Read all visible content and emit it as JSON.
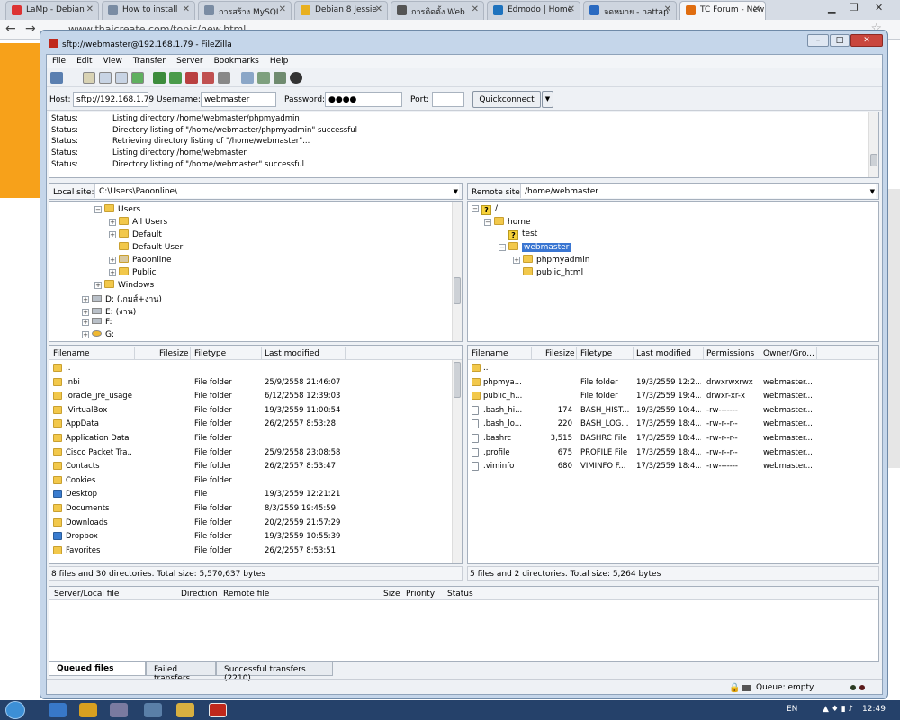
{
  "browser": {
    "tabs": [
      {
        "label": "LaMp - Debian"
      },
      {
        "label": "How to install"
      },
      {
        "label": "การสร้าง MySQL"
      },
      {
        "label": "Debian 8 Jessie"
      },
      {
        "label": "การติดตั้ง Web"
      },
      {
        "label": "Edmodo | Home"
      },
      {
        "label": "จดหมาย - nattap"
      },
      {
        "label": "TC Forum - New"
      }
    ],
    "url": "www.thaicreate.com/topic/new.html"
  },
  "window": {
    "title": "sftp://webmaster@192.168.1.79 - FileZilla",
    "minimize": "–",
    "maximize": "□",
    "close": "✕"
  },
  "menu": [
    "File",
    "Edit",
    "View",
    "Transfer",
    "Server",
    "Bookmarks",
    "Help"
  ],
  "quickconnect": {
    "host_label": "Host:",
    "host": "sftp://192.168.1.79",
    "user_label": "Username:",
    "user": "webmaster",
    "pass_label": "Password:",
    "pass": "●●●●",
    "port_label": "Port:",
    "port": "",
    "button": "Quickconnect",
    "arrow": "▼"
  },
  "log": [
    {
      "k": "Status:",
      "v": "Listing directory /home/webmaster/phpmyadmin"
    },
    {
      "k": "Status:",
      "v": "Directory listing of \"/home/webmaster/phpmyadmin\" successful"
    },
    {
      "k": "Status:",
      "v": "Retrieving directory listing of \"/home/webmaster\"..."
    },
    {
      "k": "Status:",
      "v": "Listing directory /home/webmaster"
    },
    {
      "k": "Status:",
      "v": "Directory listing of \"/home/webmaster\" successful"
    }
  ],
  "local": {
    "site_label": "Local site:",
    "path": "C:\\Users\\Paoonline\\",
    "tree": [
      {
        "label": "Users",
        "pm": "−",
        "icon": "folder"
      },
      {
        "label": "All Users",
        "pm": "+",
        "icon": "folder"
      },
      {
        "label": "Default",
        "pm": "+",
        "icon": "folder"
      },
      {
        "label": "Default User",
        "pm": "",
        "icon": "folder"
      },
      {
        "label": "Paoonline",
        "pm": "+",
        "icon": "user"
      },
      {
        "label": "Public",
        "pm": "+",
        "icon": "folder"
      },
      {
        "label": "Windows",
        "pm": "+",
        "icon": "folder"
      },
      {
        "label": "D: (เกมส์+งาน)",
        "pm": "+",
        "icon": "drive"
      },
      {
        "label": "E: (งาน)",
        "pm": "+",
        "icon": "drive"
      },
      {
        "label": "F:",
        "pm": "+",
        "icon": "drive"
      },
      {
        "label": "G:",
        "pm": "+",
        "icon": "drive"
      }
    ],
    "headers": [
      "Filename",
      "Filesize",
      "Filetype",
      "Last modified"
    ],
    "rows": [
      {
        "name": "..",
        "size": "",
        "type": "",
        "mod": "",
        "icon": "folder"
      },
      {
        "name": ".nbi",
        "size": "",
        "type": "File folder",
        "mod": "25/9/2558 21:46:07",
        "icon": "folder"
      },
      {
        "name": ".oracle_jre_usage",
        "size": "",
        "type": "File folder",
        "mod": "6/12/2558 12:39:03",
        "icon": "folder"
      },
      {
        "name": ".VirtualBox",
        "size": "",
        "type": "File folder",
        "mod": "19/3/2559 11:00:54",
        "icon": "folder"
      },
      {
        "name": "AppData",
        "size": "",
        "type": "File folder",
        "mod": "26/2/2557 8:53:28",
        "icon": "folder"
      },
      {
        "name": "Application Data",
        "size": "",
        "type": "File folder",
        "mod": "",
        "icon": "folder"
      },
      {
        "name": "Cisco Packet Tra...",
        "size": "",
        "type": "File folder",
        "mod": "25/9/2558 23:08:58",
        "icon": "folder"
      },
      {
        "name": "Contacts",
        "size": "",
        "type": "File folder",
        "mod": "26/2/2557 8:53:47",
        "icon": "folder"
      },
      {
        "name": "Cookies",
        "size": "",
        "type": "File folder",
        "mod": "",
        "icon": "folder"
      },
      {
        "name": "Desktop",
        "size": "",
        "type": "File",
        "mod": "19/3/2559 12:21:21",
        "icon": "blue"
      },
      {
        "name": "Documents",
        "size": "",
        "type": "File folder",
        "mod": "8/3/2559 19:45:59",
        "icon": "folder"
      },
      {
        "name": "Downloads",
        "size": "",
        "type": "File folder",
        "mod": "20/2/2559 21:57:29",
        "icon": "folder"
      },
      {
        "name": "Dropbox",
        "size": "",
        "type": "File folder",
        "mod": "19/3/2559 10:55:39",
        "icon": "blue"
      },
      {
        "name": "Favorites",
        "size": "",
        "type": "File folder",
        "mod": "26/2/2557 8:53:51",
        "icon": "folder"
      }
    ],
    "status": "8 files and 30 directories. Total size: 5,570,637 bytes"
  },
  "remote": {
    "site_label": "Remote site:",
    "path": "/home/webmaster",
    "tree": [
      {
        "label": "/",
        "pm": "−",
        "icon": "q"
      },
      {
        "label": "home",
        "pm": "−",
        "icon": "folder"
      },
      {
        "label": "test",
        "pm": "",
        "icon": "q"
      },
      {
        "label": "webmaster",
        "pm": "−",
        "icon": "folder"
      },
      {
        "label": "phpmyadmin",
        "pm": "+",
        "icon": "folder"
      },
      {
        "label": "public_html",
        "pm": "",
        "icon": "folder"
      }
    ],
    "headers": [
      "Filename",
      "Filesize",
      "Filetype",
      "Last modified",
      "Permissions",
      "Owner/Gro..."
    ],
    "rows": [
      {
        "name": "..",
        "size": "",
        "type": "",
        "mod": "",
        "perm": "",
        "owner": "",
        "icon": "folder"
      },
      {
        "name": "phpmya...",
        "size": "",
        "type": "File folder",
        "mod": "19/3/2559 12:2...",
        "perm": "drwxrwxrwx",
        "owner": "webmaster...",
        "icon": "folder"
      },
      {
        "name": "public_h...",
        "size": "",
        "type": "File folder",
        "mod": "17/3/2559 19:4...",
        "perm": "drwxr-xr-x",
        "owner": "webmaster...",
        "icon": "folder"
      },
      {
        "name": ".bash_hi...",
        "size": "174",
        "type": "BASH_HIST...",
        "mod": "19/3/2559 10:4...",
        "perm": "-rw-------",
        "owner": "webmaster...",
        "icon": "doc"
      },
      {
        "name": ".bash_lo...",
        "size": "220",
        "type": "BASH_LOG...",
        "mod": "17/3/2559 18:4...",
        "perm": "-rw-r--r--",
        "owner": "webmaster...",
        "icon": "doc"
      },
      {
        "name": ".bashrc",
        "size": "3,515",
        "type": "BASHRC File",
        "mod": "17/3/2559 18:4...",
        "perm": "-rw-r--r--",
        "owner": "webmaster...",
        "icon": "doc"
      },
      {
        "name": ".profile",
        "size": "675",
        "type": "PROFILE File",
        "mod": "17/3/2559 18:4...",
        "perm": "-rw-r--r--",
        "owner": "webmaster...",
        "icon": "doc"
      },
      {
        "name": ".viminfo",
        "size": "680",
        "type": "VIMINFO F...",
        "mod": "17/3/2559 18:4...",
        "perm": "-rw-------",
        "owner": "webmaster...",
        "icon": "doc"
      }
    ],
    "status": "5 files and 2 directories. Total size: 5,264 bytes"
  },
  "queue": {
    "headers": [
      "Server/Local file",
      "Direction",
      "Remote file",
      "Size",
      "Priority",
      "Status"
    ],
    "tabs": [
      "Queued files",
      "Failed transfers",
      "Successful transfers (2210)"
    ],
    "status": "Queue: empty"
  },
  "taskbar": {
    "lang": "EN",
    "time": "12:49"
  }
}
